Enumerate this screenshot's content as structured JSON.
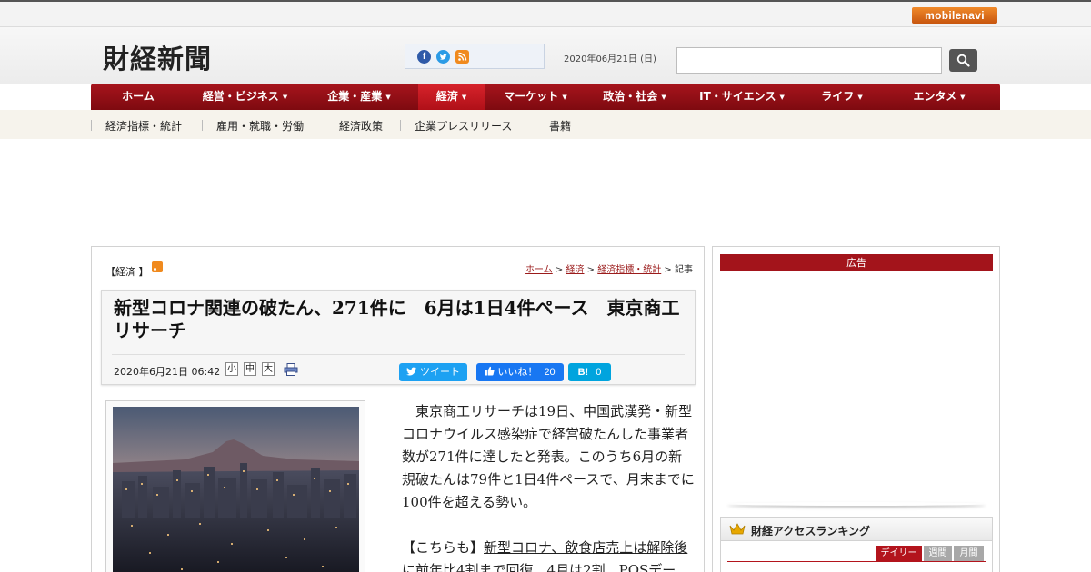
{
  "topbar": {
    "mobile_navi": "mobilenavi"
  },
  "header": {
    "logo": "財経新聞",
    "date": "2020年06月21日 (日)",
    "search": {
      "value": "",
      "placeholder": ""
    },
    "social_icons": [
      "facebook-icon",
      "twitter-icon",
      "rss-icon"
    ]
  },
  "nav": {
    "items": [
      {
        "label": "ホーム",
        "caret": ""
      },
      {
        "label": "経営・ビジネス",
        "caret": "▼"
      },
      {
        "label": "企業・産業",
        "caret": "▼"
      },
      {
        "label": "経済",
        "caret": "▼"
      },
      {
        "label": "マーケット",
        "caret": "▼"
      },
      {
        "label": "政治・社会",
        "caret": "▼"
      },
      {
        "label": "IT・サイエンス",
        "caret": "▼"
      },
      {
        "label": "ライフ",
        "caret": "▼"
      },
      {
        "label": "エンタメ",
        "caret": "▼"
      }
    ],
    "active": "経済",
    "colors": {
      "bar": "#8e0f15",
      "active": "#c8161e"
    }
  },
  "subnav": {
    "items": [
      "経済指標・統計",
      "雇用・就職・労働",
      "経済政策",
      "企業プレスリリース",
      "書籍"
    ]
  },
  "article": {
    "category": "【経済 】",
    "breadcrumb": {
      "home": "ホーム",
      "sep1": " > ",
      "section": "経済",
      "sep2": " > ",
      "subsection": "経済指標・統計",
      "sep3": " > ",
      "current": "記事"
    },
    "title": "新型コロナ関連の破たん、271件に　6月は1日4件ペース　東京商工リサーチ",
    "date": "2020年6月21日 06:42",
    "font_sizes": [
      "小",
      "中",
      "大"
    ],
    "share": {
      "tweet": "ツイート",
      "like": "いいね！",
      "like_count": "20",
      "hatena": "B!",
      "hatena_count": "0"
    },
    "body_p1": "東京商工リサーチは19日、中国武漢発・新型コロナウイルス感染症で経営破たんした事業者数が271件に達したと発表。このうち6月の新規破たんは79件と1日4件ペースで、月末までに100件を超える勢い。",
    "body_p2_prefix": "【こちらも】",
    "body_p2_link": "新型コロナ、飲食店売上は解除後に前年比4割まで回復　4月は2割　POSデー"
  },
  "sidebar": {
    "ad_label": "広告",
    "ranking_title": "財経アクセスランキング",
    "tabs": [
      "デイリー",
      "週間",
      "月間"
    ],
    "active_tab": "デイリー",
    "accent_color": "#b3141c"
  }
}
